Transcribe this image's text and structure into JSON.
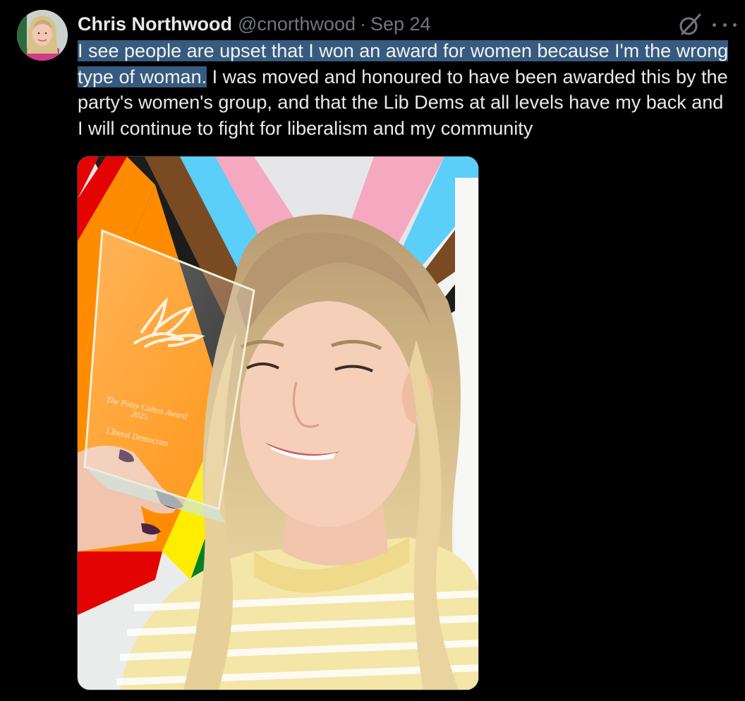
{
  "author": {
    "display_name": "Chris Northwood",
    "handle": "@cnorthwood",
    "separator": "·",
    "date": "Sep 24"
  },
  "tweet": {
    "text_highlighted": "I see people are upset that I won an award for women because I'm the wrong type of woman.",
    "text_rest": " I was moved and honoured to have been awarded this by the party's women's group, and that the Lib Dems at all levels have my back and I will continue to fight for liberalism and my community"
  },
  "media": {
    "award_lines": [
      "The Patsy Calton Award",
      "2025",
      "Liberal Democrats"
    ]
  },
  "icons": {
    "grok": "grok-icon",
    "more": "more-icon"
  },
  "colors": {
    "background": "#000000",
    "primary_text": "#e7e9ea",
    "secondary_text": "#71767b",
    "selection_highlight": "#375a7f"
  }
}
